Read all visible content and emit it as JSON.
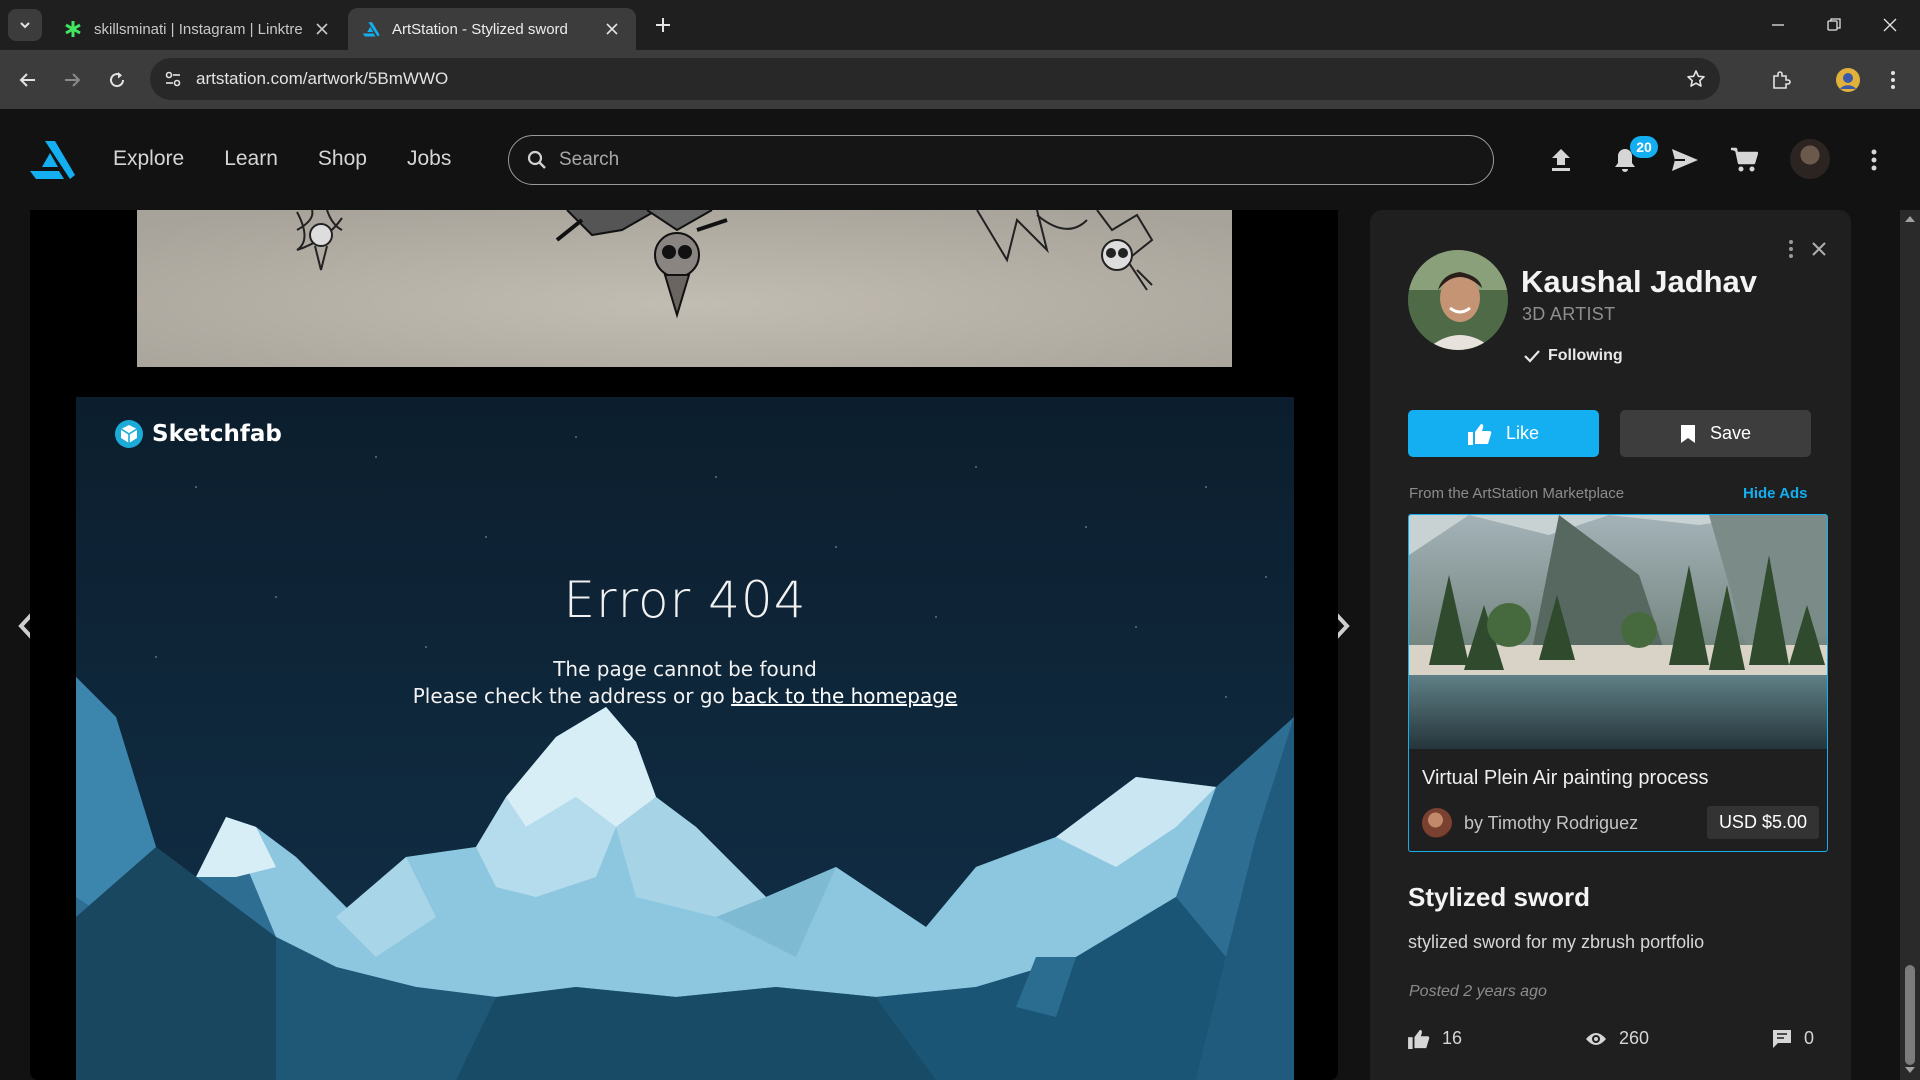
{
  "browser": {
    "tabs": [
      {
        "title": "skillsminati | Instagram | Linktre"
      },
      {
        "title": "ArtStation - Stylized sword"
      }
    ],
    "url": "artstation.com/artwork/5BmWWO"
  },
  "header": {
    "nav": [
      "Explore",
      "Learn",
      "Shop",
      "Jobs"
    ],
    "search_placeholder": "Search",
    "notifications_count": "20"
  },
  "viewer": {
    "embed_brand": "Sketchfab",
    "error_title": "Error 404",
    "error_line1": "The page cannot be found",
    "error_line2_prefix": "Please check the address or go ",
    "error_link": "back to the homepage"
  },
  "panel": {
    "artist_name": "Kaushal Jadhav",
    "artist_role": "3D ARTIST",
    "following_label": "Following",
    "like_label": "Like",
    "save_label": "Save",
    "marketplace_label": "From the ArtStation Marketplace",
    "hide_ads_label": "Hide Ads",
    "ad": {
      "title": "Virtual Plein Air painting process",
      "author": "by Timothy Rodriguez",
      "price": "USD $5.00"
    },
    "artwork_title": "Stylized sword",
    "artwork_description": "stylized sword for my zbrush portfolio",
    "posted": "Posted 2 years ago",
    "stats": {
      "likes": "16",
      "views": "260",
      "comments": "0"
    }
  },
  "colors": {
    "accent": "#13aff0",
    "panel_bg": "#1f1f1f",
    "page_bg": "#121212"
  }
}
